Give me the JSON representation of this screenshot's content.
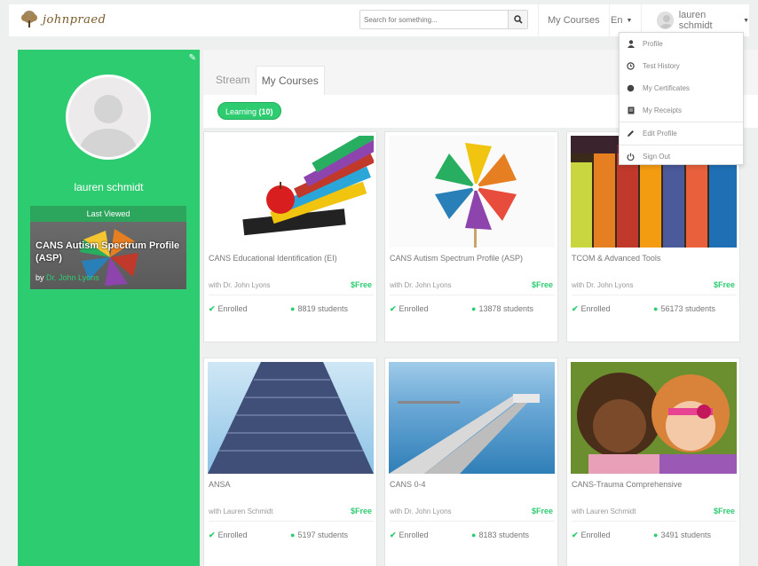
{
  "header": {
    "logo_text": "johnpraed",
    "search_placeholder": "Search for something...",
    "nav_courses": "My Courses",
    "nav_lang": "En",
    "user_name": "lauren schmidt"
  },
  "user_menu": {
    "items": [
      {
        "label": "Profile",
        "icon": "user-icon"
      },
      {
        "label": "Test History",
        "icon": "clock-icon"
      },
      {
        "label": "My Certificates",
        "icon": "certificate-icon"
      },
      {
        "label": "My Receipts",
        "icon": "receipt-icon"
      },
      {
        "label": "Edit Profile",
        "icon": "pencil-icon"
      },
      {
        "label": "Sign Out",
        "icon": "power-icon"
      }
    ]
  },
  "sidebar": {
    "user_name": "lauren schmidt",
    "last_viewed_label": "Last Viewed",
    "last_viewed_title": "CANS Autism Spectrum Profile (ASP)",
    "last_viewed_by": "by",
    "last_viewed_author": "Dr. John Lyons"
  },
  "main": {
    "tabs": [
      {
        "label": "Stream",
        "active": false
      },
      {
        "label": "My Courses",
        "active": true
      }
    ],
    "filter_label": "Learning",
    "filter_count": "(10)"
  },
  "courses": [
    {
      "title": "CANS Educational Identification (EI)",
      "instructor": "with Dr. John Lyons",
      "price": "Free",
      "status": "Enrolled",
      "students": "8819 students"
    },
    {
      "title": "CANS Autism Spectrum Profile (ASP)",
      "instructor": "with Dr. John Lyons",
      "price": "Free",
      "status": "Enrolled",
      "students": "13878 students"
    },
    {
      "title": "TCOM & Advanced Tools",
      "instructor": "with Dr. John Lyons",
      "price": "Free",
      "status": "Enrolled",
      "students": "56173 students"
    },
    {
      "title": "ANSA",
      "instructor": "with Lauren Schmidt",
      "price": "Free",
      "status": "Enrolled",
      "students": "5197 students"
    },
    {
      "title": "CANS 0-4",
      "instructor": "with Dr. John Lyons",
      "price": "Free",
      "status": "Enrolled",
      "students": "8183 students"
    },
    {
      "title": "CANS-Trauma Comprehensive",
      "instructor": "with Lauren Schmidt",
      "price": "Free",
      "status": "Enrolled",
      "students": "3491 students"
    }
  ],
  "currency_symbol": "$",
  "colors": {
    "accent": "#2ecc71",
    "sidebar": "#2ecc71"
  }
}
